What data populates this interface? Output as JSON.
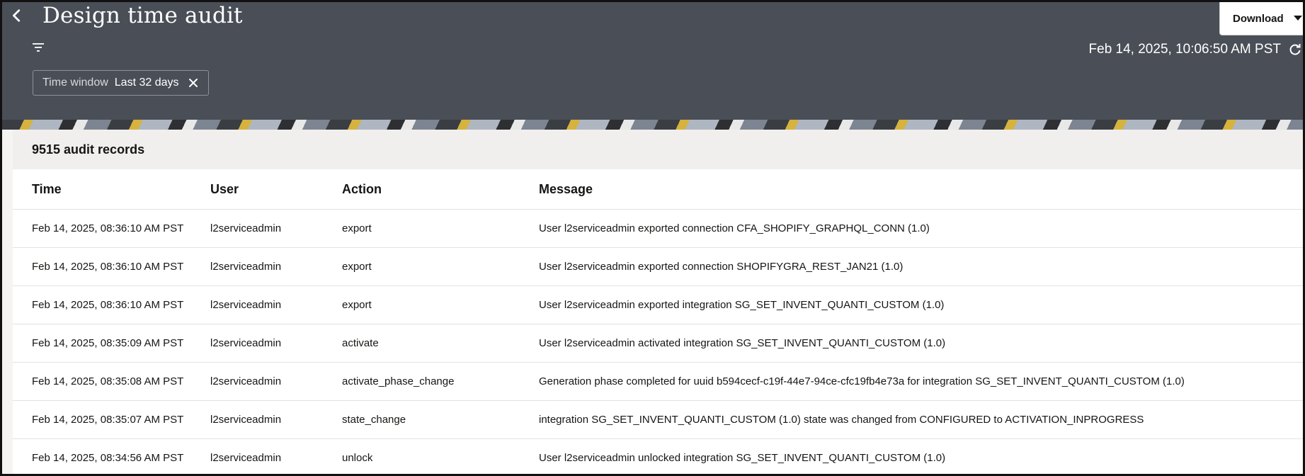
{
  "header": {
    "title": "Design time audit",
    "back_icon": "chevron-left-icon",
    "filter_icon": "filter-icon",
    "timestamp": "Feb 14, 2025, 10:06:50 AM PST",
    "refresh_icon": "refresh-icon",
    "download_label": "Download",
    "download_icon": "caret-down-icon"
  },
  "filter_chip": {
    "key": "Time window",
    "value": "Last 32 days",
    "close_icon": "close-icon"
  },
  "records": {
    "count_label": "9515 audit records"
  },
  "table": {
    "columns": [
      "Time",
      "User",
      "Action",
      "Message"
    ],
    "rows": [
      {
        "time": "Feb 14, 2025, 08:36:10 AM PST",
        "user": "l2serviceadmin",
        "action": "export",
        "message": "User l2serviceadmin exported connection CFA_SHOPIFY_GRAPHQL_CONN (1.0)"
      },
      {
        "time": "Feb 14, 2025, 08:36:10 AM PST",
        "user": "l2serviceadmin",
        "action": "export",
        "message": "User l2serviceadmin exported connection SHOPIFYGRA_REST_JAN21 (1.0)"
      },
      {
        "time": "Feb 14, 2025, 08:36:10 AM PST",
        "user": "l2serviceadmin",
        "action": "export",
        "message": "User l2serviceadmin exported integration SG_SET_INVENT_QUANTI_CUSTOM (1.0)"
      },
      {
        "time": "Feb 14, 2025, 08:35:09 AM PST",
        "user": "l2serviceadmin",
        "action": "activate",
        "message": "User l2serviceadmin activated integration SG_SET_INVENT_QUANTI_CUSTOM (1.0)"
      },
      {
        "time": "Feb 14, 2025, 08:35:08 AM PST",
        "user": "l2serviceadmin",
        "action": "activate_phase_change",
        "message": "Generation phase completed for uuid b594cecf-c19f-44e7-94ce-cfc19fb4e73a for integration SG_SET_INVENT_QUANTI_CUSTOM (1.0)"
      },
      {
        "time": "Feb 14, 2025, 08:35:07 AM PST",
        "user": "l2serviceadmin",
        "action": "state_change",
        "message": "integration SG_SET_INVENT_QUANTI_CUSTOM (1.0) state was changed from CONFIGURED to ACTIVATION_INPROGRESS"
      },
      {
        "time": "Feb 14, 2025, 08:34:56 AM PST",
        "user": "l2serviceadmin",
        "action": "unlock",
        "message": "User l2serviceadmin unlocked integration SG_SET_INVENT_QUANTI_CUSTOM (1.0)"
      }
    ]
  },
  "colors": {
    "header_bg": "#4a4f57",
    "content_bg": "#f1efed",
    "text": "#161513"
  }
}
